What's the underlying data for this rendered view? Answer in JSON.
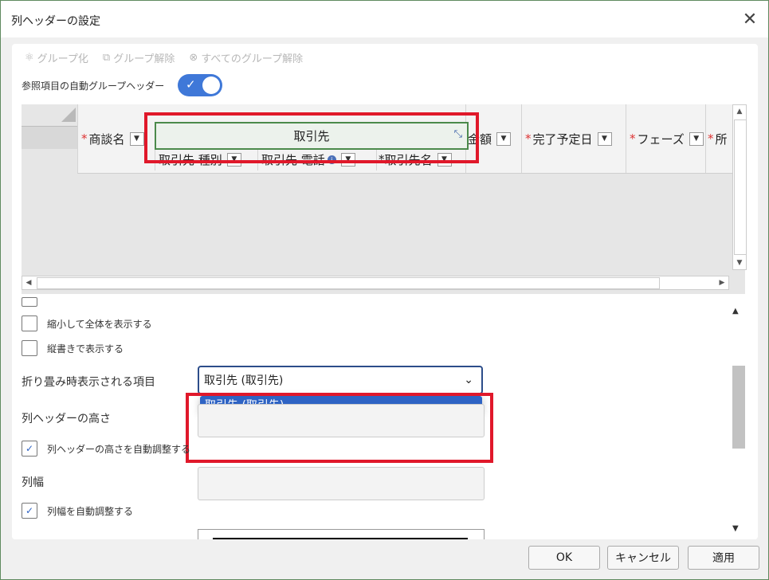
{
  "window": {
    "title": "列ヘッダーの設定"
  },
  "toolbar": {
    "group": "グループ化",
    "ungroup": "グループ解除",
    "ungroup_all": "すべてのグループ解除"
  },
  "auto_group": {
    "label": "参照項目の自動グループヘッダー",
    "enabled": true
  },
  "grid": {
    "group_header": "取引先",
    "columns": [
      {
        "label": "商談名",
        "required": true
      },
      {
        "label": "金額",
        "required": false
      },
      {
        "label": "完了予定日",
        "required": true
      },
      {
        "label": "フェーズ",
        "required": true
      },
      {
        "label": "所",
        "required": true
      }
    ],
    "sub_columns": [
      {
        "label": "取引先 種別",
        "required": false
      },
      {
        "label": "取引先 電話",
        "required": false,
        "info": true
      },
      {
        "label": "取引先名",
        "required": true
      }
    ]
  },
  "properties": {
    "shrink_to_fit": "縮小して全体を表示する",
    "vertical_text": "縦書きで表示する",
    "collapsed_item_label": "折り畳み時表示される項目",
    "collapsed_item_value": "取引先 (取引先)",
    "collapsed_item_option": "取引先 (取引先)",
    "header_height_label": "列ヘッダーの高さ",
    "header_height_auto": "列ヘッダーの高さを自動調整する",
    "header_height_auto_checked": true,
    "col_width_label": "列幅",
    "col_width_auto": "列幅を自動調整する",
    "col_width_auto_checked": true
  },
  "buttons": {
    "ok": "OK",
    "cancel": "キャンセル",
    "apply": "適用"
  },
  "colors": {
    "accent": "#3f78d8",
    "highlight": "#e0182a",
    "selected_option": "#2e63c4",
    "group_border": "#4b8a4b"
  }
}
